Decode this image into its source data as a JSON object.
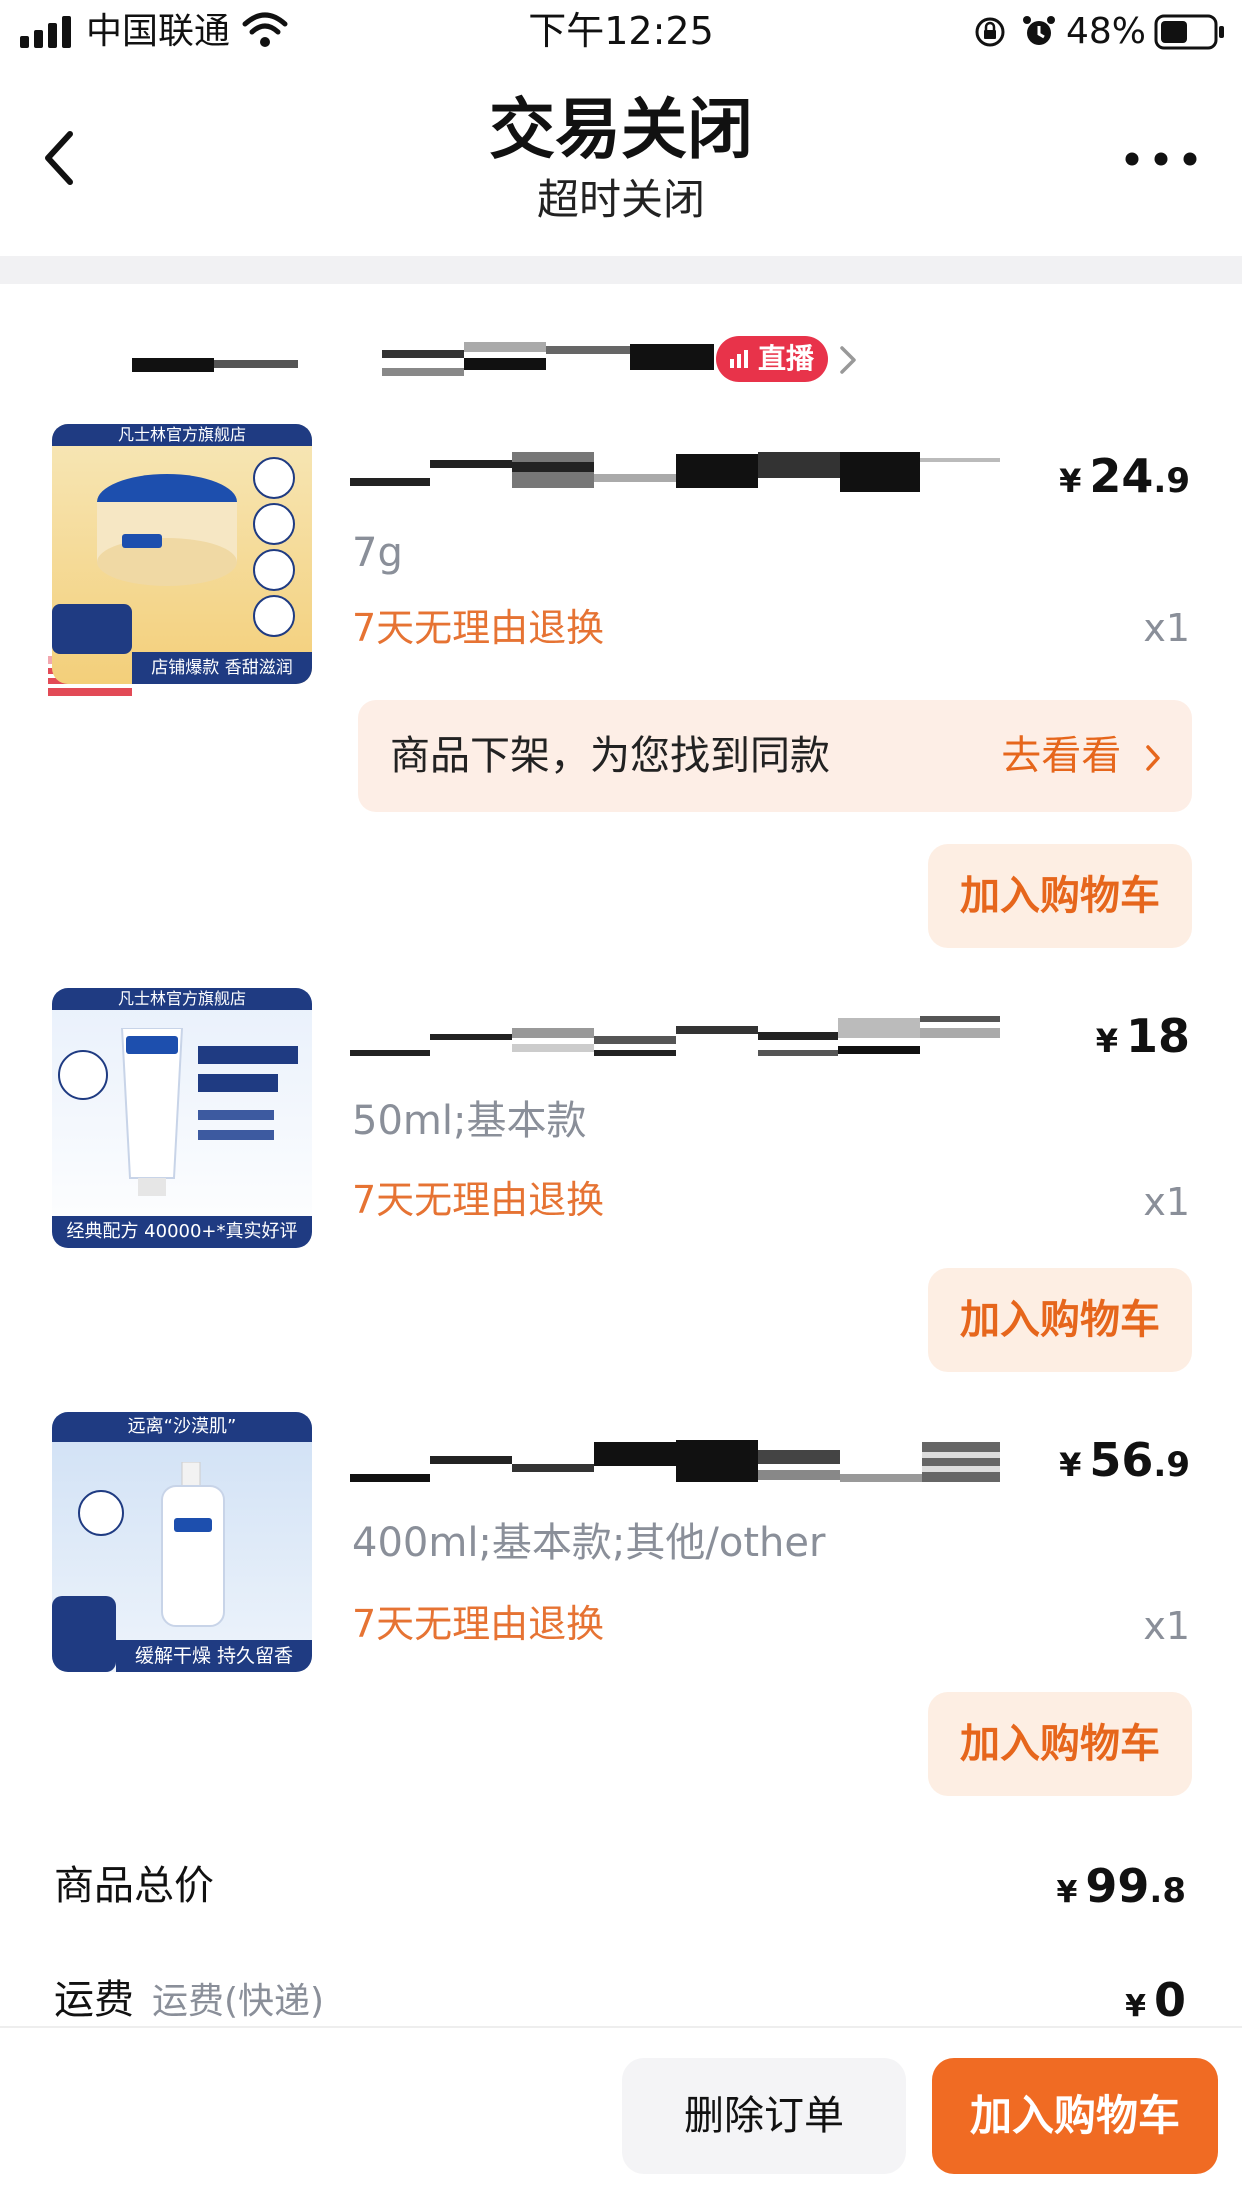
{
  "status": {
    "carrier": "中国联通",
    "time": "下午12:25",
    "battery": "48%"
  },
  "nav": {
    "title": "交易关闭",
    "subtitle": "超时关闭",
    "back_icon": "chevron-left-icon",
    "more_icon": "more-dots-icon"
  },
  "store": {
    "live_badge": "直播"
  },
  "products": [
    {
      "thumb_top": "凡士林官方旗舰店",
      "thumb_bottom": "店铺爆款 香甜滋润",
      "price_int": "24",
      "price_dec": ".9",
      "spec": "7g",
      "return": "7天无理由退换",
      "qty": "x1",
      "add_cart": "加入购物车"
    },
    {
      "thumb_top": "凡士林官方旗舰店",
      "thumb_bottom": "经典配方 40000+*真实好评",
      "price_int": "18",
      "price_dec": "",
      "spec": "50ml;基本款",
      "return": "7天无理由退换",
      "qty": "x1",
      "add_cart": "加入购物车"
    },
    {
      "thumb_top": "远离“沙漠肌”",
      "thumb_bottom": "缓解干燥 持久留香",
      "price_int": "56",
      "price_dec": ".9",
      "spec": "400ml;基本款;其他/other",
      "return": "7天无理由退换",
      "qty": "x1",
      "add_cart": "加入购物车"
    }
  ],
  "similar": {
    "text": "商品下架，为您找到同款",
    "link": "去看看"
  },
  "summary": {
    "goods_total_label": "商品总价",
    "goods_total_int": "99",
    "goods_total_dec": ".8",
    "shipping_label": "运费",
    "shipping_sub": "运费(快递)",
    "shipping_value": "0",
    "currency": "¥"
  },
  "bottom": {
    "delete": "删除订单",
    "add_cart": "加入购物车"
  },
  "colors": {
    "accent": "#f06b23",
    "accent_light": "#fdeee3",
    "return_text": "#e67333",
    "live_red": "#e8334a"
  }
}
